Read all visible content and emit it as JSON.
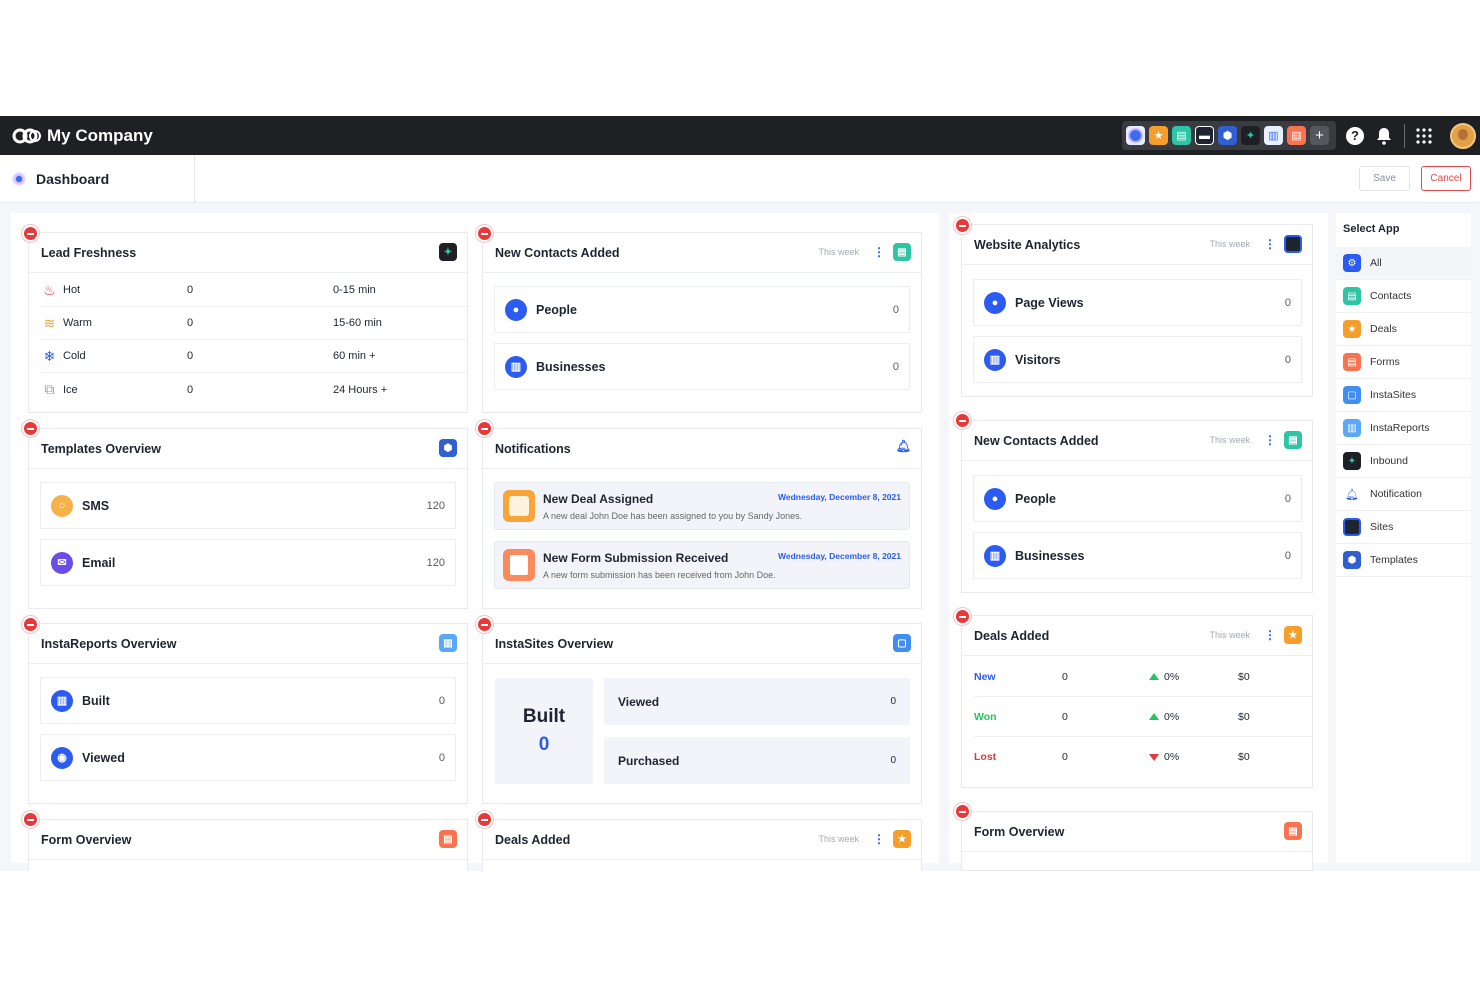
{
  "header": {
    "company": "My Company"
  },
  "subbar": {
    "tab": "Dashboard",
    "save_label": "Save",
    "cancel_label": "Cancel"
  },
  "lead_freshness": {
    "title": "Lead Freshness",
    "rows": [
      {
        "label": "Hot",
        "count": "0",
        "time": "0-15 min"
      },
      {
        "label": "Warm",
        "count": "0",
        "time": "15-60 min"
      },
      {
        "label": "Cold",
        "count": "0",
        "time": "60 min +"
      },
      {
        "label": "Ice",
        "count": "0",
        "time": "24 Hours +"
      }
    ]
  },
  "new_contacts_1": {
    "title": "New Contacts Added",
    "period": "This week",
    "people": "People",
    "people_val": "0",
    "businesses": "Businesses",
    "businesses_val": "0"
  },
  "templates": {
    "title": "Templates Overview",
    "sms": "SMS",
    "sms_val": "120",
    "email": "Email",
    "email_val": "120"
  },
  "notifications": {
    "title": "Notifications",
    "items": [
      {
        "title": "New Deal Assigned",
        "desc": "A new deal John Doe has been assigned to you by Sandy Jones.",
        "date": "Wednesday, December 8, 2021"
      },
      {
        "title": "New Form Submission Received",
        "desc": "A new form submission has been received from John Doe.",
        "date": "Wednesday, December 8, 2021"
      }
    ]
  },
  "instareports": {
    "title": "InstaReports Overview",
    "built": "Built",
    "built_val": "0",
    "viewed": "Viewed",
    "viewed_val": "0"
  },
  "instasites": {
    "title": "InstaSites Overview",
    "built": "Built",
    "built_val": "0",
    "viewed": "Viewed",
    "viewed_val": "0",
    "purchased": "Purchased",
    "purchased_val": "0"
  },
  "form_overview_1": {
    "title": "Form Overview"
  },
  "deals_added_1": {
    "title": "Deals Added",
    "period": "This week"
  },
  "website_analytics": {
    "title": "Website Analytics",
    "period": "This week",
    "page_views": "Page Views",
    "page_views_val": "0",
    "visitors": "Visitors",
    "visitors_val": "0"
  },
  "new_contacts_2": {
    "title": "New Contacts Added",
    "period": "This week",
    "people": "People",
    "people_val": "0",
    "businesses": "Businesses",
    "businesses_val": "0"
  },
  "deals_added_2": {
    "title": "Deals Added",
    "period": "This week",
    "rows": [
      {
        "label": "New",
        "count": "0",
        "pct": "0%",
        "money": "$0",
        "color": "#2b5bf0",
        "trend": "up"
      },
      {
        "label": "Won",
        "count": "0",
        "pct": "0%",
        "money": "$0",
        "color": "#22c55e",
        "trend": "up"
      },
      {
        "label": "Lost",
        "count": "0",
        "pct": "0%",
        "money": "$0",
        "color": "#e5393b",
        "trend": "down"
      }
    ]
  },
  "form_overview_2": {
    "title": "Form Overview"
  },
  "select_app": {
    "title": "Select App",
    "items": [
      "All",
      "Contacts",
      "Deals",
      "Forms",
      "InstaSites",
      "InstaReports",
      "Inbound",
      "Notification",
      "Sites",
      "Templates"
    ]
  },
  "colors": {
    "accent": "#2b5bf0",
    "danger": "#e5393b",
    "topbar": "#1f2024"
  }
}
